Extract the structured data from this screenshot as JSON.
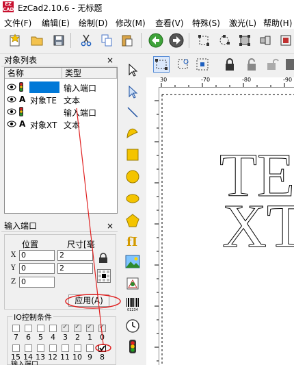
{
  "window": {
    "title": "EzCad2.10.6 - 无标题",
    "logo_text": "EZCAD"
  },
  "menu": [
    "文件(F)",
    "编辑(E)",
    "绘制(D)",
    "修改(M)",
    "查看(V)",
    "特殊(S)",
    "激光(L)",
    "帮助(H)"
  ],
  "object_list": {
    "title": "对象列表",
    "close": "×",
    "columns": [
      "名称",
      "类型"
    ],
    "rows": [
      {
        "icon": "traffic-light",
        "name": "",
        "type": "输入端口",
        "selected": true
      },
      {
        "icon": "letter-a",
        "glyph": "A",
        "name": "对象TE",
        "type": "文本",
        "selected": false
      },
      {
        "icon": "traffic-light",
        "name": "",
        "type": "输入端口",
        "selected": false
      },
      {
        "icon": "letter-a",
        "glyph": "A",
        "name": "对象XT",
        "type": "文本",
        "selected": false
      }
    ]
  },
  "input_port": {
    "title": "输入端口",
    "close": "×",
    "position_label": "位置",
    "size_label": "尺寸[毫",
    "axes": [
      "X",
      "Y",
      "Z"
    ],
    "x_value": "0",
    "y_value": "0",
    "z_value": "0",
    "w_value": "2",
    "h_value": "2",
    "apply_label": "应用(A)",
    "io_group_label": "IO控制条件",
    "row1_labels": [
      "7",
      "6",
      "5",
      "4",
      "3",
      "2",
      "1",
      "0"
    ],
    "row1_checked": [
      false,
      false,
      false,
      false,
      true,
      true,
      true,
      true
    ],
    "row2_labels": [
      "15",
      "14",
      "13",
      "12",
      "11",
      "10",
      "9",
      "8"
    ],
    "row2_checked": [
      false,
      false,
      false,
      false,
      false,
      false,
      false,
      true
    ],
    "bottom_cut_label": "输入端口"
  },
  "ruler": {
    "labels": [
      "30",
      "-70",
      "-80",
      "-90"
    ]
  },
  "canvas_text": {
    "line1": "TE",
    "line2": "XT"
  },
  "colors": {
    "selection": "#0078d7",
    "annotation": "#e02020"
  }
}
